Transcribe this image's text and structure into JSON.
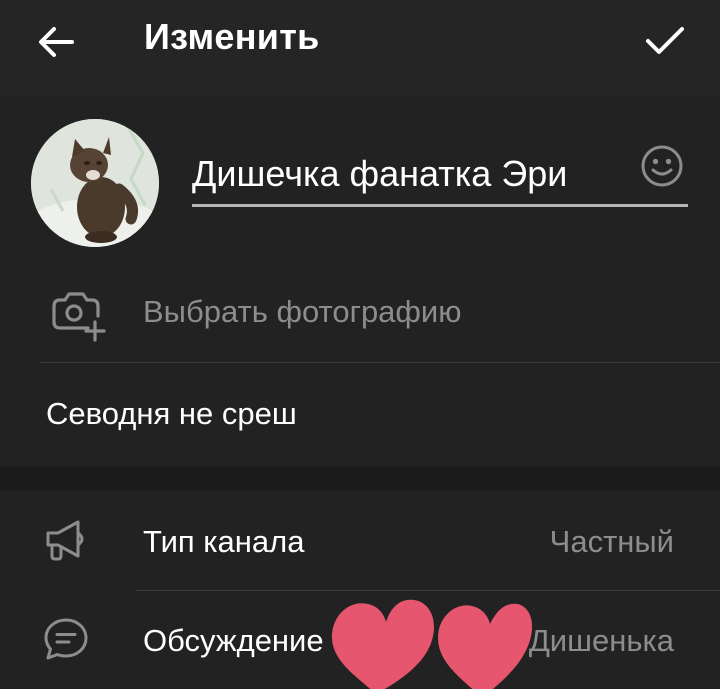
{
  "header": {
    "title": "Изменить",
    "back_icon": "arrow-left-icon",
    "done_icon": "checkmark-icon"
  },
  "channel": {
    "name": "Дишечка фанатка Эри",
    "emoji_icon": "smile-icon",
    "choose_photo_label": "Выбрать фотографию",
    "description": "Севодня не среш"
  },
  "settings": {
    "channel_type": {
      "label": "Тип канала",
      "value": "Частный",
      "icon": "megaphone-icon"
    },
    "discussion": {
      "label": "Обсуждение",
      "value": "Дишенька",
      "icon": "chat-bubble-icon"
    }
  },
  "colors": {
    "background": "#1a1a1a",
    "card": "#222222",
    "header": "#252525",
    "secondary_text": "#8d8d8d",
    "sticker_heart": "#e6566e"
  }
}
